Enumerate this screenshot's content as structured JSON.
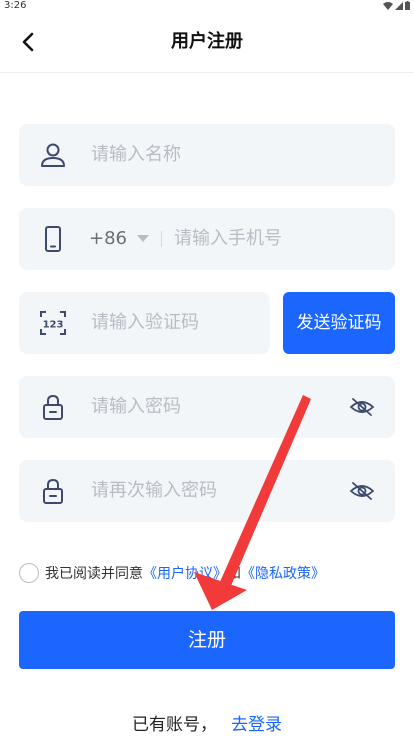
{
  "status_bar": {
    "time": "3:26"
  },
  "header": {
    "title": "用户注册"
  },
  "form": {
    "name_placeholder": "请输入名称",
    "country_code": "+86",
    "phone_placeholder": "请输入手机号",
    "code_placeholder": "请输入验证码",
    "send_code_label": "发送验证码",
    "password_placeholder": "请输入密码",
    "confirm_password_placeholder": "请再次输入密码"
  },
  "agreement": {
    "prefix": "我已阅读并同意",
    "user_agreement": "《用户协议》",
    "and": "和",
    "privacy_policy": "《隐私政策》"
  },
  "register_label": "注册",
  "footer": {
    "have_account": "已有账号，",
    "login_link": "去登录"
  },
  "colors": {
    "primary": "#1a66ff",
    "field_bg": "#f3f6f9",
    "placeholder": "#b8bcc4",
    "icon": "#3c4a6e",
    "arrow": "#f23a3a"
  },
  "icons": [
    "back-arrow-icon",
    "user-icon",
    "phone-icon",
    "dropdown-icon",
    "code-123-icon",
    "lock-icon",
    "eye-off-icon"
  ]
}
